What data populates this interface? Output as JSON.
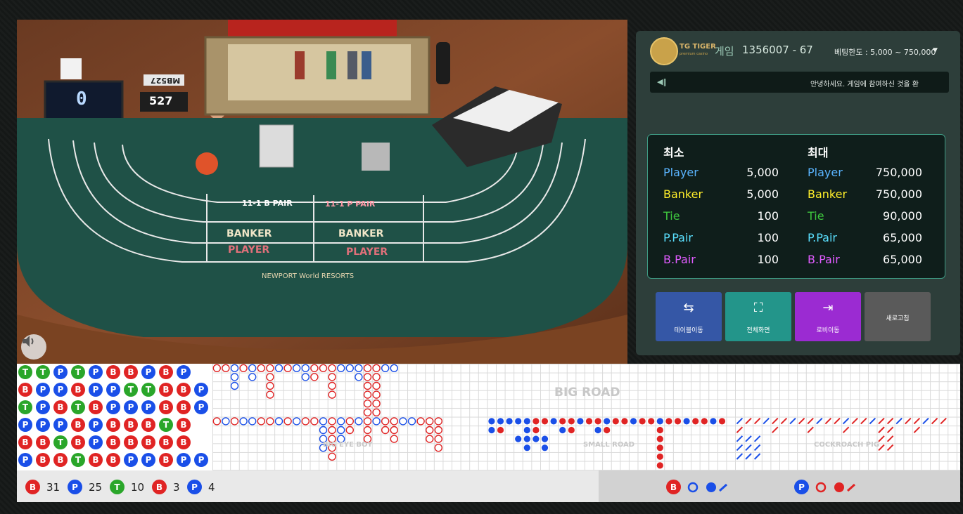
{
  "panel": {
    "brand_name": "TG TIGER",
    "brand_sub": "premium casino",
    "game_label": "게임",
    "game_id": "1356007 - 67",
    "bet_limit_label": "베팅한도 : 5,000 ~ 750,000",
    "notice_text": "안녕하세요. 게임에 참여하신 것을 환",
    "min_header": "최소",
    "max_header": "최대",
    "limits": [
      {
        "name": "Player",
        "min": "5,000",
        "max": "750,000",
        "color": "#5ab4ff"
      },
      {
        "name": "Banker",
        "min": "5,000",
        "max": "750,000",
        "color": "#ffee2a"
      },
      {
        "name": "Tie",
        "min": "100",
        "max": "90,000",
        "color": "#3ec63e"
      },
      {
        "name": "P.Pair",
        "min": "100",
        "max": "65,000",
        "color": "#5ae0ff"
      },
      {
        "name": "B.Pair",
        "min": "100",
        "max": "65,000",
        "color": "#e05cff"
      }
    ],
    "buttons": [
      {
        "label": "테이블이동",
        "icon": "swap-arrows-icon",
        "color": "#3557a6"
      },
      {
        "label": "전체화면",
        "icon": "fullscreen-icon",
        "color": "#23958a"
      },
      {
        "label": "로비이동",
        "icon": "exit-door-icon",
        "color": "#9b2bd2"
      },
      {
        "label": "새로고침",
        "icon": "",
        "color": "#5a5a5a"
      }
    ]
  },
  "video": {
    "shoe_counter": "0",
    "card_count": "527",
    "table_id": "MB527",
    "brand": "NEWPORT World RESORTS"
  },
  "roads": {
    "big_road_label": "BIG ROAD",
    "big_eye_label": "BIG EYE BOY",
    "small_road_label": "SMALL ROAD",
    "cockroach_label": "COCKROACH PIG",
    "bead_plate": [
      [
        "T",
        "T",
        "P",
        "T",
        "P",
        "B",
        "B",
        "P",
        "B",
        "P"
      ],
      [
        "B",
        "P",
        "P",
        "B",
        "P",
        "P",
        "T",
        "T",
        "B",
        "B",
        "P"
      ],
      [
        "T",
        "P",
        "B",
        "T",
        "B",
        "P",
        "P",
        "P",
        "B",
        "B",
        "P"
      ],
      [
        "P",
        "P",
        "P",
        "B",
        "P",
        "B",
        "B",
        "B",
        "T",
        "B"
      ],
      [
        "B",
        "B",
        "T",
        "B",
        "P",
        "B",
        "B",
        "B",
        "B",
        "B"
      ],
      [
        "P",
        "B",
        "B",
        "T",
        "B",
        "B",
        "P",
        "P",
        "B",
        "P",
        "P"
      ]
    ]
  },
  "stats": {
    "items": [
      {
        "symbol": "B",
        "count": "31",
        "color": "#e02424"
      },
      {
        "symbol": "P",
        "count": "25",
        "color": "#1a4fe8"
      },
      {
        "symbol": "T",
        "count": "10",
        "color": "#2aa62a"
      },
      {
        "symbol": "B",
        "count": "3",
        "color": "#e02424"
      },
      {
        "symbol": "P",
        "count": "4",
        "color": "#1a4fe8"
      }
    ],
    "predict_banker": "B",
    "predict_player": "P"
  }
}
